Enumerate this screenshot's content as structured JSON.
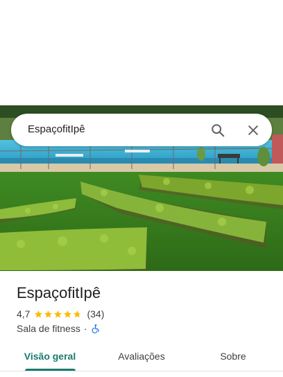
{
  "search": {
    "query": "EspaçofitIpê"
  },
  "place": {
    "title": "EspaçofitIpê",
    "rating": "4,7",
    "rating_fraction": 0.94,
    "review_count": "(34)",
    "category": "Sala de fitness",
    "separator": "·"
  },
  "tabs": [
    {
      "label": "Visão geral",
      "selected": true
    },
    {
      "label": "Avaliações",
      "selected": false
    },
    {
      "label": "Sobre",
      "selected": false
    }
  ],
  "colors": {
    "accent": "#1a7a6e",
    "star": "#fbbc04",
    "accessibility_icon": "#1a73e8"
  },
  "icons": {
    "search": "search-icon",
    "close": "close-icon",
    "accessibility": "wheelchair-icon",
    "star": "star-icon"
  }
}
